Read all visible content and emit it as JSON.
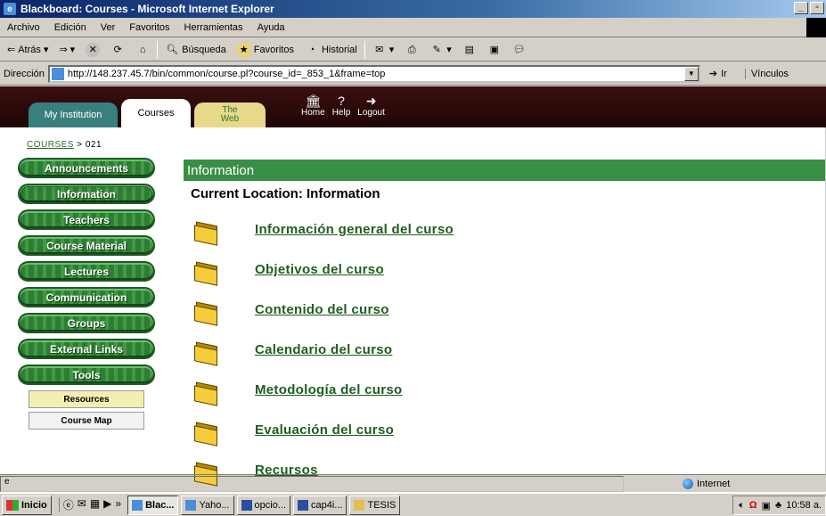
{
  "window": {
    "title": "Blackboard: Courses - Microsoft Internet Explorer"
  },
  "menu": [
    "Archivo",
    "Edición",
    "Ver",
    "Favoritos",
    "Herramientas",
    "Ayuda"
  ],
  "toolbar": {
    "back": "Atrás",
    "search": "Búsqueda",
    "favorites": "Favoritos",
    "history": "Historial"
  },
  "address": {
    "label": "Dirección",
    "url": "http://148.237.45.7/bin/common/course.pl?course_id=_853_1&frame=top",
    "go": "Ir",
    "links": "Vínculos"
  },
  "bb": {
    "tabs": {
      "my_institution": "My Institution",
      "courses": "Courses",
      "web_line1": "The",
      "web_line2": "Web"
    },
    "icons": {
      "home": "Home",
      "help": "Help",
      "logout": "Logout"
    }
  },
  "breadcrumb": {
    "root": "COURSES",
    "current": "> 021"
  },
  "nav": {
    "items": [
      "Announcements",
      "Information",
      "Teachers",
      "Course Material",
      "Lectures",
      "Communication",
      "Groups",
      "External Links",
      "Tools"
    ],
    "sub": {
      "resources": "Resources",
      "course_map": "Course Map"
    }
  },
  "content": {
    "header": "Information",
    "current_location": "Current Location: Information",
    "items": [
      "Información general del curso",
      "Objetivos del curso",
      "Contenido del curso",
      "Calendario del curso",
      "Metodología del curso",
      "Evaluación del curso",
      "Recursos"
    ]
  },
  "status": {
    "zone": "Internet"
  },
  "taskbar": {
    "start": "Inicio",
    "tasks": [
      "Blac...",
      "Yaho...",
      "opcio...",
      "cap4i...",
      "TESIS"
    ],
    "clock": "10:58 a."
  }
}
